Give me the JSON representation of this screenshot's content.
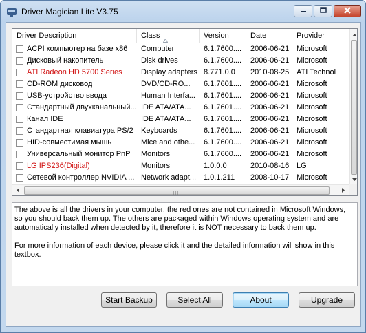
{
  "window": {
    "title": "Driver Magician Lite V3.75",
    "icon": "driver-magician-app-icon",
    "controls": [
      "minimize-icon",
      "maximize-icon",
      "close-icon"
    ]
  },
  "driver_list": {
    "columns": [
      "Driver Description",
      "Class",
      "Version",
      "Date",
      "Provider"
    ],
    "sorted_column": "Class",
    "rows": [
      {
        "desc": "ACPI компьютер на базе x86",
        "class": "Computer",
        "version": "6.1.7600....",
        "date": "2006-06-21",
        "provider": "Microsoft",
        "red": false
      },
      {
        "desc": "Дисковый накопитель",
        "class": "Disk drives",
        "version": "6.1.7600....",
        "date": "2006-06-21",
        "provider": "Microsoft",
        "red": false
      },
      {
        "desc": "ATI Radeon HD 5700 Series",
        "class": "Display adapters",
        "version": "8.771.0.0",
        "date": "2010-08-25",
        "provider": "ATI Technol",
        "red": true
      },
      {
        "desc": "CD-ROM дисковод",
        "class": "DVD/CD-RO...",
        "version": "6.1.7601....",
        "date": "2006-06-21",
        "provider": "Microsoft",
        "red": false
      },
      {
        "desc": "USB-устройство ввода",
        "class": "Human Interfa...",
        "version": "6.1.7601....",
        "date": "2006-06-21",
        "provider": "Microsoft",
        "red": false
      },
      {
        "desc": "Стандартный двухканальный...",
        "class": "IDE ATA/ATA...",
        "version": "6.1.7601....",
        "date": "2006-06-21",
        "provider": "Microsoft",
        "red": false
      },
      {
        "desc": "Канал IDE",
        "class": "IDE ATA/ATA...",
        "version": "6.1.7601....",
        "date": "2006-06-21",
        "provider": "Microsoft",
        "red": false
      },
      {
        "desc": "Стандартная клавиатура PS/2",
        "class": "Keyboards",
        "version": "6.1.7601....",
        "date": "2006-06-21",
        "provider": "Microsoft",
        "red": false
      },
      {
        "desc": "HID-совместимая мышь",
        "class": "Mice and othe...",
        "version": "6.1.7600....",
        "date": "2006-06-21",
        "provider": "Microsoft",
        "red": false
      },
      {
        "desc": "Универсальный монитор PnP",
        "class": "Monitors",
        "version": "6.1.7600....",
        "date": "2006-06-21",
        "provider": "Microsoft",
        "red": false
      },
      {
        "desc": "LG IPS236(Digital)",
        "class": "Monitors",
        "version": "1.0.0.0",
        "date": "2010-08-16",
        "provider": "LG",
        "red": true
      },
      {
        "desc": "Сетевой контроллер NVIDIA ...",
        "class": "Network adapt...",
        "version": "1.0.1.211",
        "date": "2008-10-17",
        "provider": "Microsoft",
        "red": false
      }
    ]
  },
  "info_text": {
    "paragraph1": "The above is all the drivers in your computer, the red ones are not contained in Microsoft Windows, so you should back them up. The others are packaged within Windows operating system and are automatically installed when detected by it, therefore it is NOT necessary to back them up.",
    "paragraph2": "For more information of each device, please click it and the detailed information will show in this textbox."
  },
  "buttons": {
    "start_backup": "Start Backup",
    "select_all": "Select All",
    "about": "About",
    "upgrade": "Upgrade"
  },
  "colors": {
    "non_windows_driver": "#d01010",
    "title_bar": "#bcd3ec"
  }
}
